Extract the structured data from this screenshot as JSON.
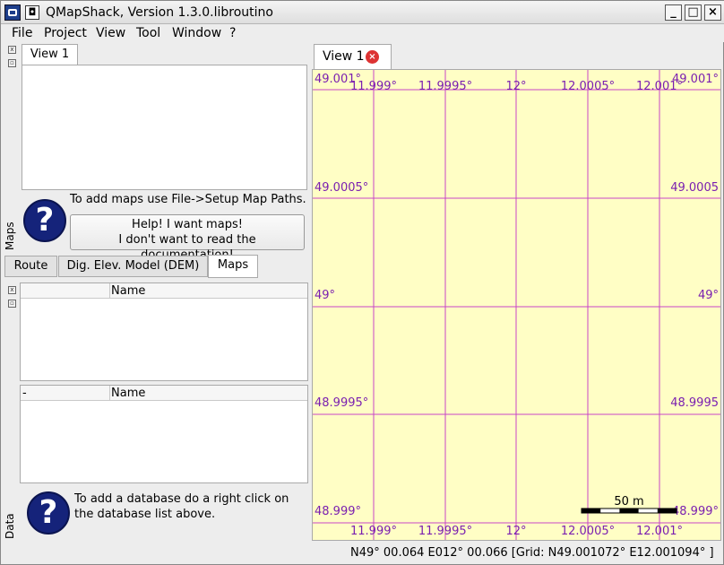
{
  "window": {
    "title": "QMapShack, Version 1.3.0.libroutino",
    "minimize": "_",
    "maximize": "□",
    "close": "×"
  },
  "menu": [
    "File",
    "Project",
    "View",
    "Tool",
    "Window",
    "?"
  ],
  "left_dock": {
    "maps_title": "Maps",
    "data_title": "Data",
    "view_tab": "View 1",
    "maps_hint": "To add maps use File->Setup Map Paths.",
    "help_button_line1": "Help! I want maps!",
    "help_button_line2": "I don't want to read the documentation!",
    "tabs": [
      "Route",
      "Dig. Elev. Model (DEM)",
      "Maps"
    ],
    "active_tab": "Maps",
    "list1_header": "Name",
    "list2_header_dash": "-",
    "list2_header": "Name",
    "data_hint": "To add a database do a right click on the database list above.",
    "data_hint_line1": "To add a database do a right click on",
    "data_hint_line2": "the database list above."
  },
  "map_view": {
    "tab_label": "View 1",
    "tab_close_icon": "close-red-icon",
    "background_color": "#fffec5",
    "grid_color": "#c845c8",
    "label_color": "#7a1fb0",
    "lat_labels_left": [
      "49.001°",
      "49.0005°",
      "49°",
      "48.9995°",
      "48.999°"
    ],
    "lat_labels_right": [
      "49.001°",
      "49.0005",
      "49°",
      "48.9995",
      "48.999°"
    ],
    "lon_labels_top": [
      "11.999°",
      "11.9995°",
      "12°",
      "12.0005°",
      "12.001°"
    ],
    "lon_labels_bottom": [
      "11.999°",
      "11.9995°",
      "12°",
      "12.0005°",
      "12.001°"
    ],
    "scale_label": "50 m"
  },
  "status": {
    "text": "N49° 00.064 E012° 00.066  [Grid: N49.001072° E12.001094° ]"
  }
}
